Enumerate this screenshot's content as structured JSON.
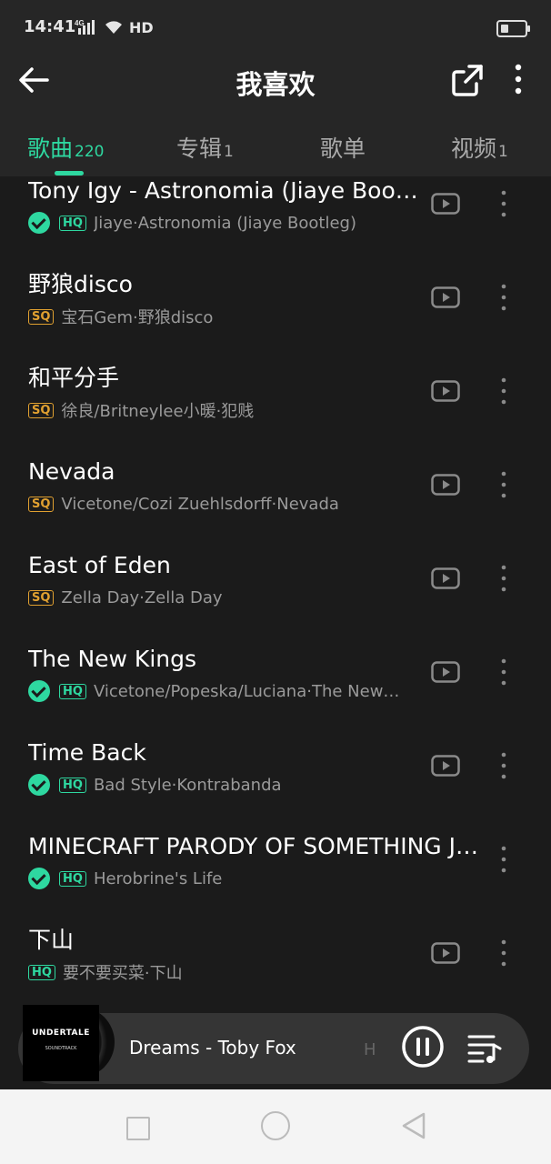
{
  "status_bar": {
    "time": "14:41",
    "network": "4G",
    "hd": "HD"
  },
  "header": {
    "title": "我喜欢"
  },
  "tabs": [
    {
      "label": "歌曲",
      "count": "220",
      "active": true
    },
    {
      "label": "专辑",
      "count": "1"
    },
    {
      "label": "歌单",
      "count": ""
    },
    {
      "label": "视频",
      "count": "1"
    }
  ],
  "songs": [
    {
      "title": "Tony Igy - Astronomia (Jiaye Bootleg)",
      "artist": "Jiaye·Astronomia (Jiaye Bootleg)",
      "quality": "HQ",
      "downloaded": true
    },
    {
      "title": "野狼disco",
      "artist": "宝石Gem·野狼disco",
      "quality": "SQ",
      "downloaded": false
    },
    {
      "title": "和平分手",
      "artist": "徐良/Britneylee小暖·犯贱",
      "quality": "SQ",
      "downloaded": false
    },
    {
      "title": "Nevada",
      "artist": "Vicetone/Cozi Zuehlsdorff·Nevada",
      "quality": "SQ",
      "downloaded": false
    },
    {
      "title": "East of Eden",
      "artist": "Zella Day·Zella Day",
      "quality": "SQ",
      "downloaded": false
    },
    {
      "title": "The New Kings",
      "artist": "Vicetone/Popeska/Luciana·The New Kings",
      "quality": "HQ",
      "downloaded": true
    },
    {
      "title": "Time Back",
      "artist": "Bad Style·Kontrabanda",
      "quality": "HQ",
      "downloaded": true
    },
    {
      "title": "MINECRAFT PARODY OF SOMETHING JUST LIKE THIS",
      "artist": "Herobrine's Life",
      "quality": "HQ",
      "downloaded": true
    },
    {
      "title": "下山",
      "artist": "要不要买菜·下山",
      "quality": "HQ",
      "downloaded": false
    }
  ],
  "player": {
    "now_playing": "Dreams - Toby Fox",
    "next_fragment": "H",
    "album_title": "UNDERTALE",
    "album_subtitle": "SOUNDTRACK"
  },
  "colors": {
    "accent": "#2ed8a0",
    "sq": "#e0a030",
    "background": "#1b1b1b",
    "header": "#262626"
  },
  "icons": {
    "back": "back-arrow-icon",
    "share": "share-icon",
    "more": "more-vertical-icon",
    "video": "play-video-icon",
    "pause": "pause-icon",
    "queue": "playlist-icon"
  }
}
